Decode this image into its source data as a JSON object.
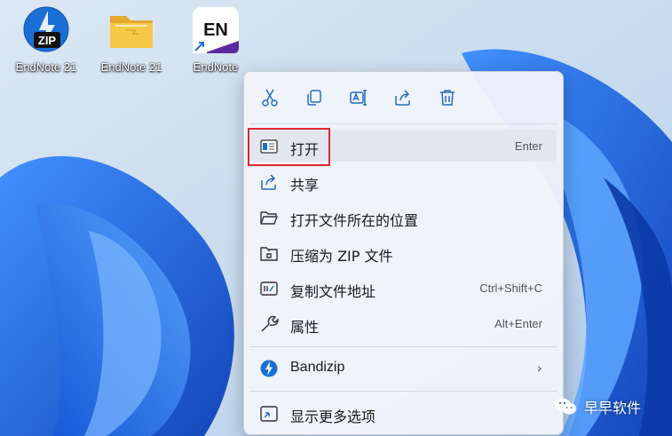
{
  "desktop": {
    "icons": [
      {
        "label": "EndNote 21",
        "icon": "bandizip-zip-icon"
      },
      {
        "label": "EndNote 21",
        "icon": "folder-icon"
      },
      {
        "label": "EndNote",
        "icon": "endnote-app-icon",
        "badge": "EN"
      }
    ]
  },
  "zip_badge": "ZIP",
  "menu": {
    "toolbar": [
      "cut-icon",
      "copy-icon",
      "rename-icon",
      "share-icon",
      "delete-icon"
    ],
    "items": [
      {
        "label": "打开",
        "shortcut": "Enter",
        "icon": "open-app-icon"
      },
      {
        "label": "共享",
        "shortcut": "",
        "icon": "share-icon"
      },
      {
        "label": "打开文件所在的位置",
        "shortcut": "",
        "icon": "folder-open-icon"
      },
      {
        "label": "压缩为 ZIP 文件",
        "shortcut": "",
        "icon": "zip-folder-icon"
      },
      {
        "label": "复制文件地址",
        "shortcut": "Ctrl+Shift+C",
        "icon": "copy-path-icon"
      },
      {
        "label": "属性",
        "shortcut": "Alt+Enter",
        "icon": "wrench-icon"
      },
      {
        "label": "Bandizip",
        "shortcut": "",
        "icon": "bandizip-icon",
        "submenu": "›"
      },
      {
        "label": "显示更多选项",
        "shortcut": "",
        "icon": "more-options-icon"
      }
    ]
  },
  "watermark": {
    "text": "早早软件",
    "icon": "wechat-icon"
  },
  "colors": {
    "highlight": "#e0262d",
    "accent": "#1a6fd6"
  }
}
